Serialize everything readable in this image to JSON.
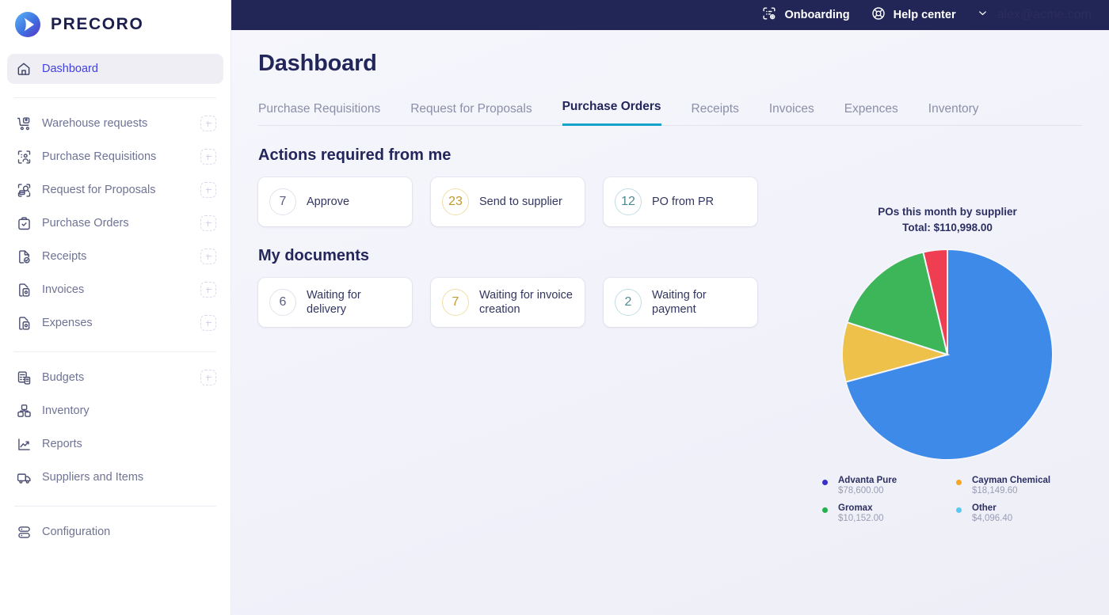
{
  "brand": {
    "name": "PRECORO",
    "logo_icon": "precoro-logo-icon"
  },
  "topbar": {
    "onboarding_label": "Onboarding",
    "onboarding_icon": "onboarding-icon",
    "help_label": "Help center",
    "help_icon": "lifebuoy-icon",
    "chevron_icon": "chevron-down-icon",
    "user_email": "alex@acme.com"
  },
  "sidebar": {
    "primary": [
      {
        "label": "Dashboard",
        "icon": "home-icon",
        "active": true,
        "add": false
      }
    ],
    "documents": [
      {
        "label": "Warehouse requests",
        "icon": "warehouse-request-icon",
        "add": true
      },
      {
        "label": "Purchase Requisitions",
        "icon": "purchase-requisition-icon",
        "add": true
      },
      {
        "label": "Request for Proposals",
        "icon": "request-for-proposal-icon",
        "add": true
      },
      {
        "label": "Purchase Orders",
        "icon": "purchase-order-icon",
        "add": true
      },
      {
        "label": "Receipts",
        "icon": "receipt-icon",
        "add": true
      },
      {
        "label": "Invoices",
        "icon": "invoice-icon",
        "add": true
      },
      {
        "label": "Expenses",
        "icon": "expense-icon",
        "add": true
      }
    ],
    "management": [
      {
        "label": "Budgets",
        "icon": "budget-icon",
        "add": true
      },
      {
        "label": "Inventory",
        "icon": "inventory-icon",
        "add": false
      },
      {
        "label": "Reports",
        "icon": "reports-icon",
        "add": false
      },
      {
        "label": "Suppliers and Items",
        "icon": "suppliers-icon",
        "add": false
      }
    ],
    "footer": [
      {
        "label": "Configuration",
        "icon": "configuration-icon",
        "add": false
      }
    ]
  },
  "page": {
    "title": "Dashboard"
  },
  "tabs": [
    {
      "label": "Purchase Requisitions",
      "active": false
    },
    {
      "label": "Request for Proposals",
      "active": false
    },
    {
      "label": "Purchase Orders",
      "active": true
    },
    {
      "label": "Receipts",
      "active": false
    },
    {
      "label": "Invoices",
      "active": false
    },
    {
      "label": "Expences",
      "active": false
    },
    {
      "label": "Inventory",
      "active": false
    }
  ],
  "actions_section": {
    "title": "Actions required from me",
    "cards": [
      {
        "count": "7",
        "label": "Approve",
        "tone": "gray"
      },
      {
        "count": "23",
        "label": "Send to supplier",
        "tone": "amber"
      },
      {
        "count": "12",
        "label": "PO from PR",
        "tone": "teal"
      }
    ]
  },
  "documents_section": {
    "title": "My documents",
    "cards": [
      {
        "count": "6",
        "label": "Waiting for delivery",
        "tone": "gray"
      },
      {
        "count": "7",
        "label": "Waiting for invoice creation",
        "tone": "amber"
      },
      {
        "count": "2",
        "label": "Waiting for payment",
        "tone": "teal"
      }
    ]
  },
  "chart_data": {
    "type": "pie",
    "title": "POs this month by supplier",
    "subtitle": "Total: $110,998.00",
    "total": 110998.0,
    "legend_position": "bottom",
    "categories": [
      "Advanta Pure",
      "Cayman Chemical",
      "Gromax",
      "Other"
    ],
    "values": [
      78600.0,
      18149.6,
      10152.0,
      4096.4
    ],
    "value_labels": [
      "$78,600.00",
      "$18,149.60",
      "$10,152.00",
      "$4,096.40"
    ],
    "percents": [
      70.8,
      16.4,
      9.1,
      3.7
    ],
    "slice_colors": [
      "#3d8ae8",
      "#eec24a",
      "#3db65a",
      "#ef3e52"
    ],
    "slice_order": [
      "Advanta Pure",
      "Gromax",
      "Cayman Chemical",
      "Other"
    ],
    "legend_dot_colors": [
      "#3730c9",
      "#f5a623",
      "#22b14c",
      "#5ac8f0"
    ]
  }
}
